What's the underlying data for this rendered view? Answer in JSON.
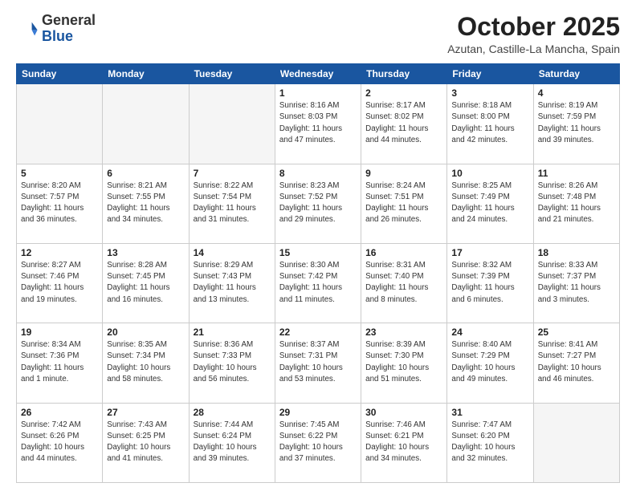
{
  "logo": {
    "general": "General",
    "blue": "Blue"
  },
  "header": {
    "month": "October 2025",
    "location": "Azutan, Castille-La Mancha, Spain"
  },
  "days_of_week": [
    "Sunday",
    "Monday",
    "Tuesday",
    "Wednesday",
    "Thursday",
    "Friday",
    "Saturday"
  ],
  "weeks": [
    [
      {
        "day": "",
        "info": ""
      },
      {
        "day": "",
        "info": ""
      },
      {
        "day": "",
        "info": ""
      },
      {
        "day": "1",
        "info": "Sunrise: 8:16 AM\nSunset: 8:03 PM\nDaylight: 11 hours\nand 47 minutes."
      },
      {
        "day": "2",
        "info": "Sunrise: 8:17 AM\nSunset: 8:02 PM\nDaylight: 11 hours\nand 44 minutes."
      },
      {
        "day": "3",
        "info": "Sunrise: 8:18 AM\nSunset: 8:00 PM\nDaylight: 11 hours\nand 42 minutes."
      },
      {
        "day": "4",
        "info": "Sunrise: 8:19 AM\nSunset: 7:59 PM\nDaylight: 11 hours\nand 39 minutes."
      }
    ],
    [
      {
        "day": "5",
        "info": "Sunrise: 8:20 AM\nSunset: 7:57 PM\nDaylight: 11 hours\nand 36 minutes."
      },
      {
        "day": "6",
        "info": "Sunrise: 8:21 AM\nSunset: 7:55 PM\nDaylight: 11 hours\nand 34 minutes."
      },
      {
        "day": "7",
        "info": "Sunrise: 8:22 AM\nSunset: 7:54 PM\nDaylight: 11 hours\nand 31 minutes."
      },
      {
        "day": "8",
        "info": "Sunrise: 8:23 AM\nSunset: 7:52 PM\nDaylight: 11 hours\nand 29 minutes."
      },
      {
        "day": "9",
        "info": "Sunrise: 8:24 AM\nSunset: 7:51 PM\nDaylight: 11 hours\nand 26 minutes."
      },
      {
        "day": "10",
        "info": "Sunrise: 8:25 AM\nSunset: 7:49 PM\nDaylight: 11 hours\nand 24 minutes."
      },
      {
        "day": "11",
        "info": "Sunrise: 8:26 AM\nSunset: 7:48 PM\nDaylight: 11 hours\nand 21 minutes."
      }
    ],
    [
      {
        "day": "12",
        "info": "Sunrise: 8:27 AM\nSunset: 7:46 PM\nDaylight: 11 hours\nand 19 minutes."
      },
      {
        "day": "13",
        "info": "Sunrise: 8:28 AM\nSunset: 7:45 PM\nDaylight: 11 hours\nand 16 minutes."
      },
      {
        "day": "14",
        "info": "Sunrise: 8:29 AM\nSunset: 7:43 PM\nDaylight: 11 hours\nand 13 minutes."
      },
      {
        "day": "15",
        "info": "Sunrise: 8:30 AM\nSunset: 7:42 PM\nDaylight: 11 hours\nand 11 minutes."
      },
      {
        "day": "16",
        "info": "Sunrise: 8:31 AM\nSunset: 7:40 PM\nDaylight: 11 hours\nand 8 minutes."
      },
      {
        "day": "17",
        "info": "Sunrise: 8:32 AM\nSunset: 7:39 PM\nDaylight: 11 hours\nand 6 minutes."
      },
      {
        "day": "18",
        "info": "Sunrise: 8:33 AM\nSunset: 7:37 PM\nDaylight: 11 hours\nand 3 minutes."
      }
    ],
    [
      {
        "day": "19",
        "info": "Sunrise: 8:34 AM\nSunset: 7:36 PM\nDaylight: 11 hours\nand 1 minute."
      },
      {
        "day": "20",
        "info": "Sunrise: 8:35 AM\nSunset: 7:34 PM\nDaylight: 10 hours\nand 58 minutes."
      },
      {
        "day": "21",
        "info": "Sunrise: 8:36 AM\nSunset: 7:33 PM\nDaylight: 10 hours\nand 56 minutes."
      },
      {
        "day": "22",
        "info": "Sunrise: 8:37 AM\nSunset: 7:31 PM\nDaylight: 10 hours\nand 53 minutes."
      },
      {
        "day": "23",
        "info": "Sunrise: 8:39 AM\nSunset: 7:30 PM\nDaylight: 10 hours\nand 51 minutes."
      },
      {
        "day": "24",
        "info": "Sunrise: 8:40 AM\nSunset: 7:29 PM\nDaylight: 10 hours\nand 49 minutes."
      },
      {
        "day": "25",
        "info": "Sunrise: 8:41 AM\nSunset: 7:27 PM\nDaylight: 10 hours\nand 46 minutes."
      }
    ],
    [
      {
        "day": "26",
        "info": "Sunrise: 7:42 AM\nSunset: 6:26 PM\nDaylight: 10 hours\nand 44 minutes."
      },
      {
        "day": "27",
        "info": "Sunrise: 7:43 AM\nSunset: 6:25 PM\nDaylight: 10 hours\nand 41 minutes."
      },
      {
        "day": "28",
        "info": "Sunrise: 7:44 AM\nSunset: 6:24 PM\nDaylight: 10 hours\nand 39 minutes."
      },
      {
        "day": "29",
        "info": "Sunrise: 7:45 AM\nSunset: 6:22 PM\nDaylight: 10 hours\nand 37 minutes."
      },
      {
        "day": "30",
        "info": "Sunrise: 7:46 AM\nSunset: 6:21 PM\nDaylight: 10 hours\nand 34 minutes."
      },
      {
        "day": "31",
        "info": "Sunrise: 7:47 AM\nSunset: 6:20 PM\nDaylight: 10 hours\nand 32 minutes."
      },
      {
        "day": "",
        "info": ""
      }
    ]
  ]
}
